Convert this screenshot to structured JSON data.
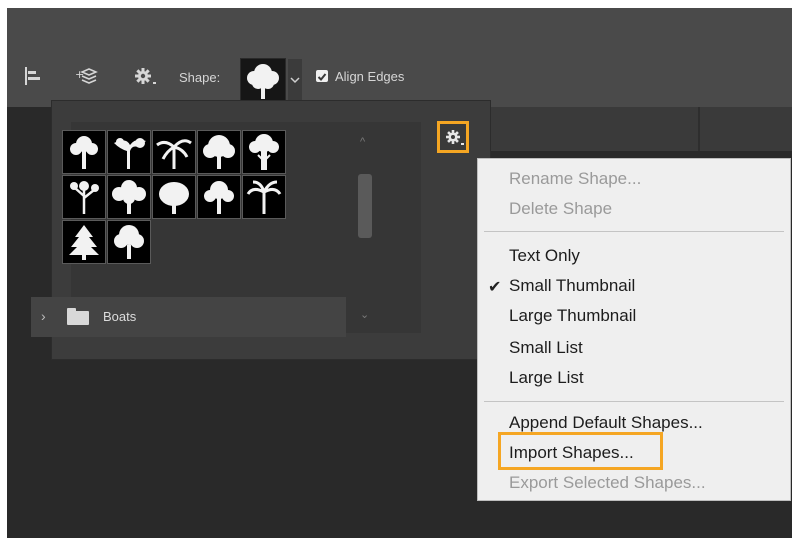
{
  "toolbar": {
    "shape_label": "Shape:",
    "align_edges_label": "Align Edges",
    "align_edges_checked": true,
    "icons": [
      "align-left-icon",
      "transform-icon",
      "gear-icon",
      "chevron-down-icon"
    ]
  },
  "picker": {
    "folder_label": "Boats",
    "shape_count": 12
  },
  "menu": {
    "items": [
      {
        "label": "Rename Shape...",
        "enabled": false
      },
      {
        "label": "Delete Shape",
        "enabled": false
      },
      {
        "label": "Text Only",
        "enabled": true
      },
      {
        "label": "Small Thumbnail",
        "enabled": true,
        "checked": true
      },
      {
        "label": "Large Thumbnail",
        "enabled": true
      },
      {
        "label": "Small List",
        "enabled": true
      },
      {
        "label": "Large List",
        "enabled": true
      },
      {
        "label": "Append Default Shapes...",
        "enabled": true
      },
      {
        "label": "Import Shapes...",
        "enabled": true,
        "highlighted": true
      },
      {
        "label": "Export Selected Shapes...",
        "enabled": false
      }
    ]
  },
  "colors": {
    "highlight": "#f5a623",
    "panel": "#3c3c3c",
    "menu_bg": "#efefef"
  }
}
